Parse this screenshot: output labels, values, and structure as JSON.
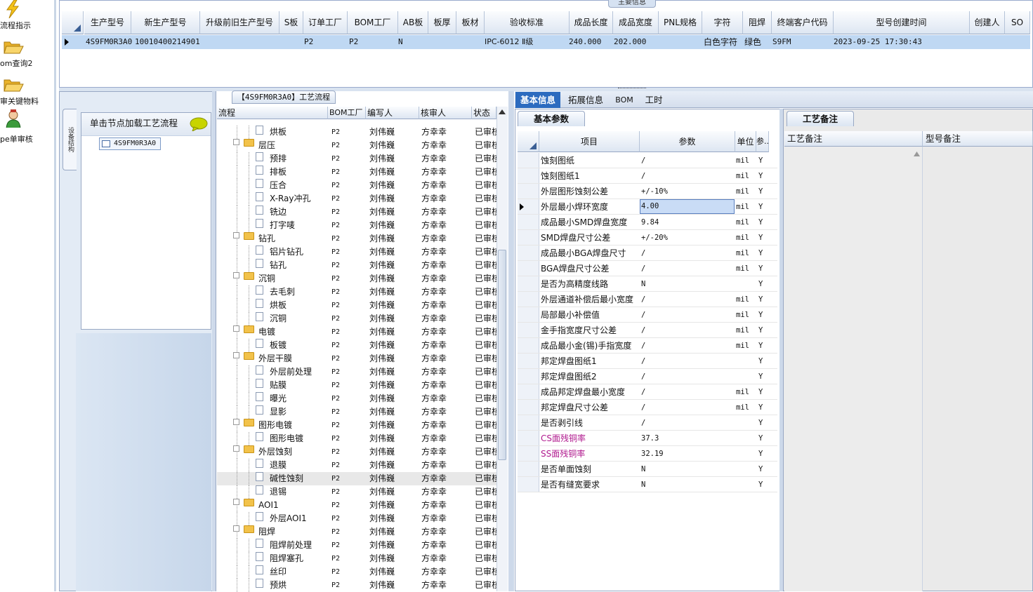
{
  "nav": [
    {
      "label": "流程指示",
      "icon": "lightning-icon"
    },
    {
      "label": "om查询2",
      "icon": "folder-open-icon"
    },
    {
      "label": "审关键物料",
      "icon": "folder-open-icon"
    },
    {
      "label": "pe单审核",
      "icon": "user-icon"
    }
  ],
  "top": {
    "caption": "主要信息",
    "columns": [
      "生产型号",
      "新生产型号",
      "升级前旧生产型号",
      "S板",
      "订单工厂",
      "BOM工厂",
      "AB板",
      "板厚",
      "板材",
      "验收标准",
      "成品长度",
      "成品宽度",
      "PNL规格",
      "字符",
      "阻焊",
      "终端客户代码",
      "型号创建时间",
      "创建人",
      "SO"
    ],
    "row": {
      "model": "4S9FM0R3A0",
      "new_model": "10010400214901",
      "order_factory": "P2",
      "bom_factory": "P2",
      "ab": "N",
      "standard": "IPC-6012 Ⅱ级",
      "length": "240.000",
      "width": "202.000",
      "char": "白色字符",
      "mask": "绿色",
      "customer": "S9FM",
      "created": "2023-09-25 17:30:43"
    }
  },
  "left": {
    "vertical_tab": "设备结构",
    "node_header": "单击节点加载工艺流程",
    "root_node": "4S9FM0R3A0"
  },
  "process": {
    "caption": "【4S9FM0R3A0】工艺流程",
    "columns": [
      "流程",
      "BOM工厂",
      "编写人",
      "核审人",
      "状态"
    ],
    "rows": [
      {
        "name": "烘板",
        "type": "doc",
        "factory": "P2",
        "writer": "刘伟巍",
        "reviewer": "方幸幸",
        "status": "已审核"
      },
      {
        "name": "层压",
        "type": "folder",
        "factory": "P2",
        "writer": "刘伟巍",
        "reviewer": "方幸幸",
        "status": "已审核"
      },
      {
        "name": "预排",
        "type": "doc",
        "factory": "P2",
        "writer": "刘伟巍",
        "reviewer": "方幸幸",
        "status": "已审核"
      },
      {
        "name": "排板",
        "type": "doc",
        "factory": "P2",
        "writer": "刘伟巍",
        "reviewer": "方幸幸",
        "status": "已审核"
      },
      {
        "name": "压合",
        "type": "doc",
        "factory": "P2",
        "writer": "刘伟巍",
        "reviewer": "方幸幸",
        "status": "已审核"
      },
      {
        "name": "X-Ray冲孔",
        "type": "doc",
        "factory": "P2",
        "writer": "刘伟巍",
        "reviewer": "方幸幸",
        "status": "已审核"
      },
      {
        "name": "铣边",
        "type": "doc",
        "factory": "P2",
        "writer": "刘伟巍",
        "reviewer": "方幸幸",
        "status": "已审核"
      },
      {
        "name": "打字唛",
        "type": "doc",
        "factory": "P2",
        "writer": "刘伟巍",
        "reviewer": "方幸幸",
        "status": "已审核"
      },
      {
        "name": "钻孔",
        "type": "folder",
        "factory": "P2",
        "writer": "刘伟巍",
        "reviewer": "方幸幸",
        "status": "已审核"
      },
      {
        "name": "铝片钻孔",
        "type": "doc",
        "factory": "P2",
        "writer": "刘伟巍",
        "reviewer": "方幸幸",
        "status": "已审核"
      },
      {
        "name": "钻孔",
        "type": "doc",
        "factory": "P2",
        "writer": "刘伟巍",
        "reviewer": "方幸幸",
        "status": "已审核"
      },
      {
        "name": "沉铜",
        "type": "folder",
        "factory": "P2",
        "writer": "刘伟巍",
        "reviewer": "方幸幸",
        "status": "已审核"
      },
      {
        "name": "去毛刺",
        "type": "doc",
        "factory": "P2",
        "writer": "刘伟巍",
        "reviewer": "方幸幸",
        "status": "已审核"
      },
      {
        "name": "烘板",
        "type": "doc",
        "factory": "P2",
        "writer": "刘伟巍",
        "reviewer": "方幸幸",
        "status": "已审核"
      },
      {
        "name": "沉铜",
        "type": "doc",
        "factory": "P2",
        "writer": "刘伟巍",
        "reviewer": "方幸幸",
        "status": "已审核"
      },
      {
        "name": "电镀",
        "type": "folder",
        "factory": "P2",
        "writer": "刘伟巍",
        "reviewer": "方幸幸",
        "status": "已审核"
      },
      {
        "name": "板镀",
        "type": "doc",
        "factory": "P2",
        "writer": "刘伟巍",
        "reviewer": "方幸幸",
        "status": "已审核"
      },
      {
        "name": "外层干膜",
        "type": "folder",
        "factory": "P2",
        "writer": "刘伟巍",
        "reviewer": "方幸幸",
        "status": "已审核"
      },
      {
        "name": "外层前处理",
        "type": "doc",
        "factory": "P2",
        "writer": "刘伟巍",
        "reviewer": "方幸幸",
        "status": "已审核"
      },
      {
        "name": "贴膜",
        "type": "doc",
        "factory": "P2",
        "writer": "刘伟巍",
        "reviewer": "方幸幸",
        "status": "已审核"
      },
      {
        "name": "曝光",
        "type": "doc",
        "factory": "P2",
        "writer": "刘伟巍",
        "reviewer": "方幸幸",
        "status": "已审核"
      },
      {
        "name": "显影",
        "type": "doc",
        "factory": "P2",
        "writer": "刘伟巍",
        "reviewer": "方幸幸",
        "status": "已审核"
      },
      {
        "name": "图形电镀",
        "type": "folder",
        "factory": "P2",
        "writer": "刘伟巍",
        "reviewer": "方幸幸",
        "status": "已审核"
      },
      {
        "name": "图形电镀",
        "type": "doc",
        "factory": "P2",
        "writer": "刘伟巍",
        "reviewer": "方幸幸",
        "status": "已审核"
      },
      {
        "name": "外层蚀刻",
        "type": "folder",
        "factory": "P2",
        "writer": "刘伟巍",
        "reviewer": "方幸幸",
        "status": "已审核"
      },
      {
        "name": "退膜",
        "type": "doc",
        "factory": "P2",
        "writer": "刘伟巍",
        "reviewer": "方幸幸",
        "status": "已审核"
      },
      {
        "name": "碱性蚀刻",
        "type": "doc",
        "factory": "P2",
        "writer": "刘伟巍",
        "reviewer": "方幸幸",
        "status": "已审核",
        "selected": true
      },
      {
        "name": "退锡",
        "type": "doc",
        "factory": "P2",
        "writer": "刘伟巍",
        "reviewer": "方幸幸",
        "status": "已审核"
      },
      {
        "name": "AOI1",
        "type": "folder",
        "factory": "P2",
        "writer": "刘伟巍",
        "reviewer": "方幸幸",
        "status": "已审核"
      },
      {
        "name": "外层AOI1",
        "type": "doc",
        "factory": "P2",
        "writer": "刘伟巍",
        "reviewer": "方幸幸",
        "status": "已审核"
      },
      {
        "name": "阻焊",
        "type": "folder",
        "factory": "P2",
        "writer": "刘伟巍",
        "reviewer": "方幸幸",
        "status": "已审核"
      },
      {
        "name": "阻焊前处理",
        "type": "doc",
        "factory": "P2",
        "writer": "刘伟巍",
        "reviewer": "方幸幸",
        "status": "已审核"
      },
      {
        "name": "阻焊塞孔",
        "type": "doc",
        "factory": "P2",
        "writer": "刘伟巍",
        "reviewer": "方幸幸",
        "status": "已审核"
      },
      {
        "name": "丝印",
        "type": "doc",
        "factory": "P2",
        "writer": "刘伟巍",
        "reviewer": "方幸幸",
        "status": "已审核"
      },
      {
        "name": "预烘",
        "type": "doc",
        "factory": "P2",
        "writer": "刘伟巍",
        "reviewer": "方幸幸",
        "status": "已审核"
      }
    ]
  },
  "tabs": [
    "基本信息",
    "拓展信息",
    "BOM",
    "工时"
  ],
  "basic": {
    "caption": "基本参数",
    "columns": [
      "项目",
      "参数",
      "单位",
      "参.."
    ],
    "rows": [
      {
        "item": "蚀刻图纸",
        "value": "/",
        "unit": "mil",
        "flag": "Y"
      },
      {
        "item": "蚀刻图纸1",
        "value": "/",
        "unit": "mil",
        "flag": "Y"
      },
      {
        "item": "外层图形蚀刻公差",
        "value": "+/-10%",
        "unit": "mil",
        "flag": "Y"
      },
      {
        "item": "外层最小焊环宽度",
        "value": "4.00",
        "unit": "mil",
        "flag": "Y",
        "current": true
      },
      {
        "item": "成品最小SMD焊盘宽度",
        "value": "9.84",
        "unit": "mil",
        "flag": "Y"
      },
      {
        "item": "SMD焊盘尺寸公差",
        "value": "+/-20%",
        "unit": "mil",
        "flag": "Y"
      },
      {
        "item": "成品最小BGA焊盘尺寸",
        "value": "/",
        "unit": "mil",
        "flag": "Y"
      },
      {
        "item": "BGA焊盘尺寸公差",
        "value": "/",
        "unit": "mil",
        "flag": "Y"
      },
      {
        "item": "是否为高精度线路",
        "value": "N",
        "unit": "",
        "flag": "Y"
      },
      {
        "item": "外层通道补偿后最小宽度",
        "value": "/",
        "unit": "mil",
        "flag": "Y"
      },
      {
        "item": "局部最小补偿值",
        "value": "/",
        "unit": "mil",
        "flag": "Y"
      },
      {
        "item": "金手指宽度尺寸公差",
        "value": "/",
        "unit": "mil",
        "flag": "Y"
      },
      {
        "item": "成品最小金(锡)手指宽度",
        "value": "/",
        "unit": "mil",
        "flag": "Y"
      },
      {
        "item": "邦定焊盘图纸1",
        "value": "/",
        "unit": "",
        "flag": "Y"
      },
      {
        "item": "邦定焊盘图纸2",
        "value": "/",
        "unit": "",
        "flag": "Y"
      },
      {
        "item": "成品邦定焊盘最小宽度",
        "value": "/",
        "unit": "mil",
        "flag": "Y"
      },
      {
        "item": "邦定焊盘尺寸公差",
        "value": "/",
        "unit": "mil",
        "flag": "Y"
      },
      {
        "item": "是否剥引线",
        "value": "/",
        "unit": "",
        "flag": "Y"
      },
      {
        "item": "CS面残铜率",
        "value": "37.3",
        "unit": "",
        "flag": "Y",
        "magenta": true
      },
      {
        "item": "SS面残铜率",
        "value": "32.19",
        "unit": "",
        "flag": "Y",
        "magenta": true
      },
      {
        "item": "是否单面蚀刻",
        "value": "N",
        "unit": "",
        "flag": "Y"
      },
      {
        "item": "是否有缝宽要求",
        "value": "N",
        "unit": "",
        "flag": "Y"
      }
    ]
  },
  "remark": {
    "caption": "工艺备注",
    "columns": [
      "工艺备注",
      "型号备注"
    ]
  },
  "colors": {
    "accent": "#2c6bbf",
    "selected_row": "#bfd8f3",
    "magenta": "#b0198e"
  }
}
